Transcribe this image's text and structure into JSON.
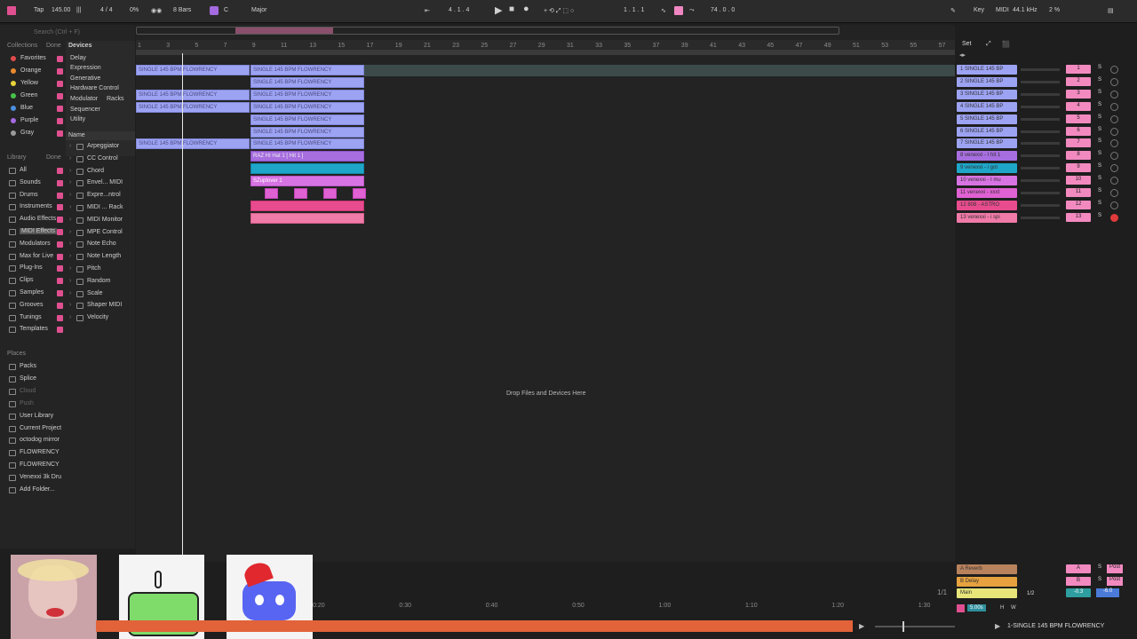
{
  "topbar": {
    "tap": "Tap",
    "tempo": "145.00",
    "meter": "4 / 4",
    "zoom": "0%",
    "bars": "8 Bars",
    "key_root": "C",
    "scale": "Major",
    "position": "4 . 1 . 4",
    "loop_pos": "1 . 1 . 1",
    "loop_len": "74 . 0 . 0",
    "key_label": "Key",
    "midi_label": "MIDI",
    "sample_rate": "44.1 kHz",
    "cpu": "2 %"
  },
  "browser": {
    "search_placeholder": "Search (Ctrl + F)",
    "collections_title": "Collections",
    "done1": "Done",
    "collections": [
      {
        "label": "Favorites",
        "color": "#e14b4b"
      },
      {
        "label": "Orange",
        "color": "#e98a2e"
      },
      {
        "label": "Yellow",
        "color": "#e7d33a"
      },
      {
        "label": "Green",
        "color": "#47c24a"
      },
      {
        "label": "Blue",
        "color": "#4c8fe0"
      },
      {
        "label": "Purple",
        "color": "#a56ae0"
      },
      {
        "label": "Gray",
        "color": "#9a9a9a"
      }
    ],
    "library_title": "Library",
    "done2": "Done",
    "library": [
      "All",
      "Sounds",
      "Drums",
      "Instruments",
      "Audio Effects",
      "MIDI Effects",
      "Modulators",
      "Max for Live",
      "Plug-Ins",
      "Clips",
      "Samples",
      "Grooves",
      "Tunings",
      "Templates"
    ],
    "places_title": "Places",
    "places": [
      "Packs",
      "Splice",
      "Cloud",
      "Push",
      "User Library",
      "Current Project",
      "octodog mirror",
      "FLOWRENCY",
      "FLOWRENCY",
      "Venexxi 3k Dru",
      "Add Folder..."
    ],
    "devices_title": "Devices",
    "device_cats": [
      "Delay",
      "Expression",
      "Generative",
      "Hardware Control",
      "Modulator",
      "Racks",
      "Sequencer",
      "Utility"
    ],
    "name_header": "Name",
    "devices": [
      "Arpeggiator",
      "CC Control",
      "Chord",
      "Envel... MIDI",
      "Expre...ntrol",
      "MIDI ... Rack",
      "MIDI Monitor",
      "MPE Control",
      "Note Echo",
      "Note Length",
      "Pitch",
      "Random",
      "Scale",
      "Shaper MIDI",
      "Velocity"
    ]
  },
  "ruler": [
    "1",
    "3",
    "5",
    "7",
    "9",
    "11",
    "13",
    "15",
    "17",
    "19",
    "21",
    "23",
    "25",
    "27",
    "29",
    "31",
    "33",
    "35",
    "37",
    "39",
    "41",
    "43",
    "45",
    "47",
    "49",
    "51",
    "53",
    "55",
    "57"
  ],
  "clip_text": "SINGLE 145 BPM FLOWRENCY",
  "clips_extra": {
    "hihat": "RAZ HI Hat 1 [ Hit 1 ]",
    "sub": "SZuptover 1"
  },
  "drop_text": "Drop Files and Devices Here",
  "set_label": "Set",
  "tracks": [
    {
      "name": "1 SINGLE 145 BP",
      "num": "1",
      "color": "#9da3f3"
    },
    {
      "name": "2 SINGLE 145 BP",
      "num": "2",
      "color": "#9da3f3"
    },
    {
      "name": "3 SINGLE 145 BP",
      "num": "3",
      "color": "#9da3f3"
    },
    {
      "name": "4 SINGLE 145 BP",
      "num": "4",
      "color": "#9da3f3"
    },
    {
      "name": "5 SINGLE 145 BP",
      "num": "5",
      "color": "#9da3f3"
    },
    {
      "name": "6 SINGLE 145 BP",
      "num": "6",
      "color": "#9da3f3"
    },
    {
      "name": "7 SINGLE 145 BP",
      "num": "7",
      "color": "#9da3f3"
    },
    {
      "name": "8 venexxi - I hit 1",
      "num": "8",
      "color": "#a76ee0"
    },
    {
      "name": "9 venexxi - i got",
      "num": "9",
      "color": "#1ea6c9"
    },
    {
      "name": "10 venexxi - I mu",
      "num": "10",
      "color": "#d873e3"
    },
    {
      "name": "11 venexxi - xxxt",
      "num": "11",
      "color": "#e061d3"
    },
    {
      "name": "12 808 - ASTRO",
      "num": "12",
      "color": "#e84c8e"
    },
    {
      "name": "13 venexxi - i spi",
      "num": "13",
      "color": "#f07aa8"
    }
  ],
  "returns": [
    {
      "name": "A Reverb",
      "color": "#b8825c",
      "num": "A"
    },
    {
      "name": "B Delay",
      "color": "#e7a23f",
      "num": "B"
    }
  ],
  "main": {
    "name": "Main",
    "color": "#e7e57a",
    "ratio": "1/2",
    "vol": "-0.3",
    "pan": "-6.0",
    "post": "Post",
    "page": "1/1"
  },
  "time_ruler": [
    "0:20",
    "0:30",
    "0:40",
    "0:50",
    "1:00",
    "1:10",
    "1:20",
    "1:30"
  ],
  "status": {
    "track_name": "1-SINGLE 145 BPM FLOWRENCY",
    "zoom": "5.00s",
    "h": "H",
    "w": "W"
  }
}
